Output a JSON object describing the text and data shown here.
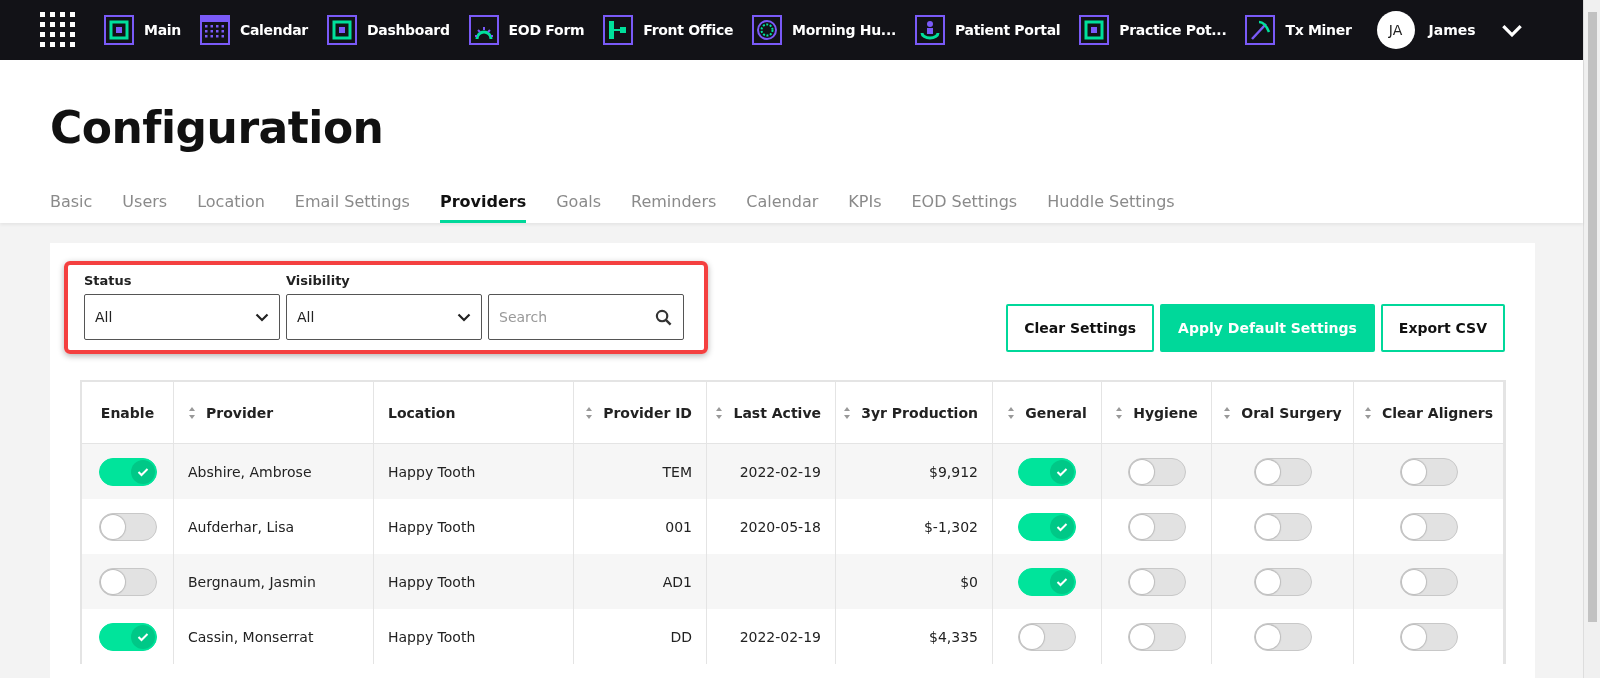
{
  "nav": {
    "items": [
      {
        "label": "Main",
        "kind": "square"
      },
      {
        "label": "Calendar",
        "kind": "grid"
      },
      {
        "label": "Dashboard",
        "kind": "square"
      },
      {
        "label": "EOD Form",
        "kind": "gauge"
      },
      {
        "label": "Front Office",
        "kind": "flow"
      },
      {
        "label": "Morning Hu...",
        "kind": "dial"
      },
      {
        "label": "Patient Portal",
        "kind": "person"
      },
      {
        "label": "Practice Pot...",
        "kind": "square"
      },
      {
        "label": "Tx Miner",
        "kind": "pick"
      }
    ],
    "user": {
      "initials": "JA",
      "name": "James"
    }
  },
  "page": {
    "title": "Configuration"
  },
  "tabs": [
    {
      "label": "Basic",
      "selected": false
    },
    {
      "label": "Users",
      "selected": false
    },
    {
      "label": "Location",
      "selected": false
    },
    {
      "label": "Email Settings",
      "selected": false
    },
    {
      "label": "Providers",
      "selected": true
    },
    {
      "label": "Goals",
      "selected": false
    },
    {
      "label": "Reminders",
      "selected": false
    },
    {
      "label": "Calendar",
      "selected": false
    },
    {
      "label": "KPIs",
      "selected": false
    },
    {
      "label": "EOD Settings",
      "selected": false
    },
    {
      "label": "Huddle Settings",
      "selected": false
    }
  ],
  "filters": {
    "status": {
      "label": "Status",
      "value": "All"
    },
    "visibility": {
      "label": "Visibility",
      "value": "All"
    },
    "search": {
      "placeholder": "Search"
    }
  },
  "buttons": [
    {
      "label": "Clear Settings",
      "kind": "outline"
    },
    {
      "label": "Apply Default Settings",
      "kind": "primary"
    },
    {
      "label": "Export CSV",
      "kind": "outline"
    }
  ],
  "table": {
    "columns": [
      {
        "label": "Enable",
        "sortable": false
      },
      {
        "label": "Provider",
        "sortable": true
      },
      {
        "label": "Location",
        "sortable": false
      },
      {
        "label": "Provider ID",
        "sortable": true
      },
      {
        "label": "Last Active",
        "sortable": true
      },
      {
        "label": "3yr Production",
        "sortable": true
      },
      {
        "label": "General",
        "sortable": true
      },
      {
        "label": "Hygiene",
        "sortable": true
      },
      {
        "label": "Oral Surgery",
        "sortable": true
      },
      {
        "label": "Clear Aligners",
        "sortable": true
      }
    ],
    "rows": [
      {
        "enabled": true,
        "provider": "Abshire, Ambrose",
        "location": "Happy Tooth",
        "provider_id": "TEM",
        "last_active": "2022-02-19",
        "production": "$9,912",
        "general": true,
        "hygiene": false,
        "oral_surgery": false,
        "clear_aligners": false
      },
      {
        "enabled": false,
        "provider": "Aufderhar, Lisa",
        "location": "Happy Tooth",
        "provider_id": "001",
        "last_active": "2020-05-18",
        "production": "$-1,302",
        "general": true,
        "hygiene": false,
        "oral_surgery": false,
        "clear_aligners": false
      },
      {
        "enabled": false,
        "provider": "Bergnaum, Jasmin",
        "location": "Happy Tooth",
        "provider_id": "AD1",
        "production": "$0",
        "general": true,
        "hygiene": false,
        "oral_surgery": false,
        "clear_aligners": false
      },
      {
        "enabled": true,
        "provider": "Cassin, Monserrat",
        "location": "Happy Tooth",
        "provider_id": "DD",
        "last_active": "2022-02-19",
        "production": "$4,335",
        "general": false,
        "hygiene": false,
        "oral_surgery": false,
        "clear_aligners": false
      }
    ]
  }
}
